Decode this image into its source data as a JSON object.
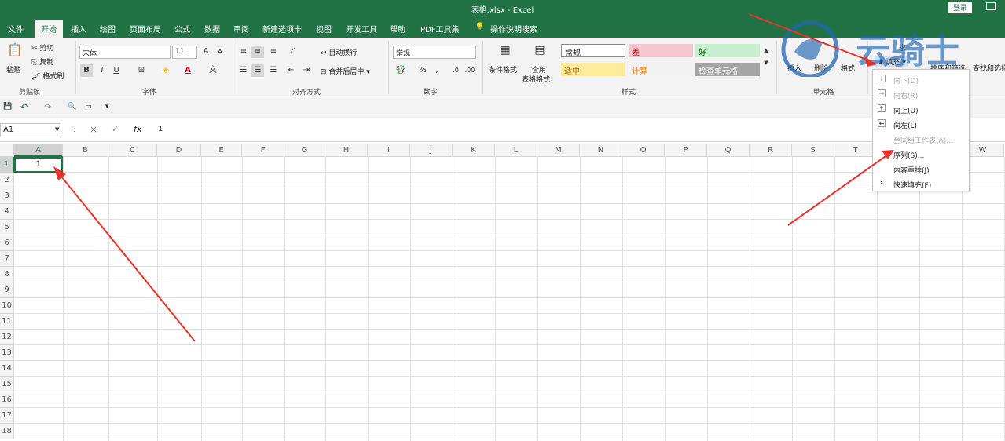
{
  "window": {
    "title": "表格.xlsx  -  Excel",
    "login_label": "登录"
  },
  "tabs": [
    "文件",
    "开始",
    "插入",
    "绘图",
    "页面布局",
    "公式",
    "数据",
    "审阅",
    "新建选项卡",
    "视图",
    "开发工具",
    "帮助",
    "PDF工具集",
    "操作说明搜索"
  ],
  "active_tab": "开始",
  "clipboard": {
    "paste": "粘贴",
    "cut": "剪切",
    "copy": "复制",
    "format_painter": "格式刷",
    "group": "剪贴板"
  },
  "font": {
    "name": "宋体",
    "size": "11",
    "bold": "B",
    "italic": "I",
    "underline": "U",
    "group": "字体",
    "grow": "A",
    "shrink": "A"
  },
  "alignment": {
    "wrap": "自动换行",
    "merge": "合并后居中",
    "group": "对齐方式"
  },
  "number": {
    "format": "常规",
    "percent": "%",
    "comma": ",",
    "group": "数字"
  },
  "styles": {
    "conditional": "条件格式",
    "table_format_1": "套用",
    "table_format_2": "表格格式",
    "cells": [
      {
        "label": "常规",
        "bg": "#ffffff",
        "fg": "#222222"
      },
      {
        "label": "差",
        "bg": "#f4c7ce",
        "fg": "#9c0006"
      },
      {
        "label": "好",
        "bg": "#c6efce",
        "fg": "#006100"
      },
      {
        "label": "适中",
        "bg": "#ffeb9c",
        "fg": "#9c6500"
      },
      {
        "label": "计算",
        "bg": "#f2f2f2",
        "fg": "#fa7d00"
      },
      {
        "label": "检查单元格",
        "bg": "#a5a5a5",
        "fg": "#ffffff"
      }
    ],
    "group": "样式"
  },
  "cells_group": {
    "insert": "插入",
    "delete": "删除",
    "format": "格式",
    "group": "单元格"
  },
  "editing": {
    "sum_partial": "求",
    "fill": "填充",
    "sort_filter": "排序和筛选",
    "find_select": "查找和选择"
  },
  "formula_bar": {
    "name_box": "A1",
    "cancel": "×",
    "enter": "✓",
    "fx": "fx",
    "value": "1"
  },
  "columns": [
    "A",
    "B",
    "C",
    "D",
    "E",
    "F",
    "G",
    "H",
    "I",
    "J",
    "K",
    "L",
    "M",
    "N",
    "O",
    "P",
    "Q",
    "R",
    "S",
    "T",
    "U",
    "V",
    "W"
  ],
  "rows": [
    "1",
    "2",
    "3",
    "4",
    "5",
    "6",
    "7",
    "8",
    "9",
    "10",
    "11",
    "12",
    "13",
    "14",
    "15",
    "16",
    "17",
    "18"
  ],
  "cell_a1": "1",
  "fill_menu": [
    {
      "label": "向下(D)",
      "disabled": true,
      "icon": "↓"
    },
    {
      "label": "向右(R)",
      "disabled": true,
      "icon": "→"
    },
    {
      "label": "向上(U)",
      "disabled": false,
      "icon": "↑"
    },
    {
      "label": "向左(L)",
      "disabled": false,
      "icon": "←"
    },
    {
      "label": "至同组工作表(A)...",
      "disabled": true,
      "icon": ""
    },
    {
      "label": "序列(S)...",
      "disabled": false,
      "icon": ""
    },
    {
      "label": "内容重排(J)",
      "disabled": false,
      "icon": ""
    },
    {
      "label": "快速填充(F)",
      "disabled": false,
      "icon": "⚡"
    }
  ],
  "watermark": {
    "text": "云骑士"
  },
  "colors": {
    "brand": "#217346",
    "arrow": "#e8332b",
    "watermark": "#1f66b3"
  }
}
